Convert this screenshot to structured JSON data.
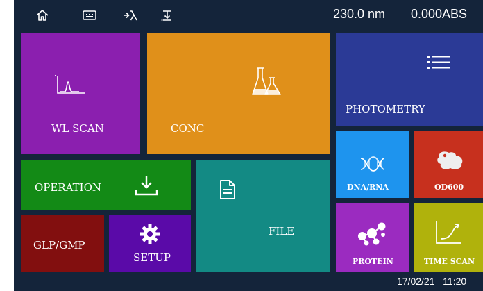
{
  "status_bar": {
    "icons": [
      "home-icon",
      "keypad-icon",
      "lambda-goto-icon",
      "zero-baseline-icon"
    ],
    "wavelength": "230.0 nm",
    "absorbance": "0.000ABS"
  },
  "tiles": {
    "wl_scan": {
      "label": "WL SCAN",
      "color": "#8b1faf",
      "icon": "spectrum-peak-icon"
    },
    "conc": {
      "label": "CONC",
      "color": "#e0901a",
      "icon": "flasks-icon"
    },
    "photometry": {
      "label": "PHOTOMETRY",
      "color": "#2b3a96",
      "icon": "list-icon"
    },
    "operation": {
      "label": "OPERATION",
      "color": "#138a16",
      "icon": "download-icon"
    },
    "file": {
      "label": "FILE",
      "color": "#138a84",
      "icon": "document-icon"
    },
    "dna_rna": {
      "label": "DNA/RNA",
      "color": "#1e94ee",
      "icon": "dna-helix-icon"
    },
    "od600": {
      "label": "OD600",
      "color": "#c7301e",
      "icon": "cell-icon"
    },
    "glp_gmp": {
      "label": "GLP/GMP",
      "color": "#820f0f",
      "icon": ""
    },
    "setup": {
      "label": "SETUP",
      "color": "#5a0aa8",
      "icon": "gear-icon"
    },
    "protein": {
      "label": "PROTEIN",
      "color": "#9b2bc0",
      "icon": "molecule-icon"
    },
    "time_scan": {
      "label": "TIME SCAN",
      "color": "#b0b20c",
      "icon": "kinetic-curve-icon"
    }
  },
  "footer": {
    "datetime": "17/02/21   11:20"
  }
}
